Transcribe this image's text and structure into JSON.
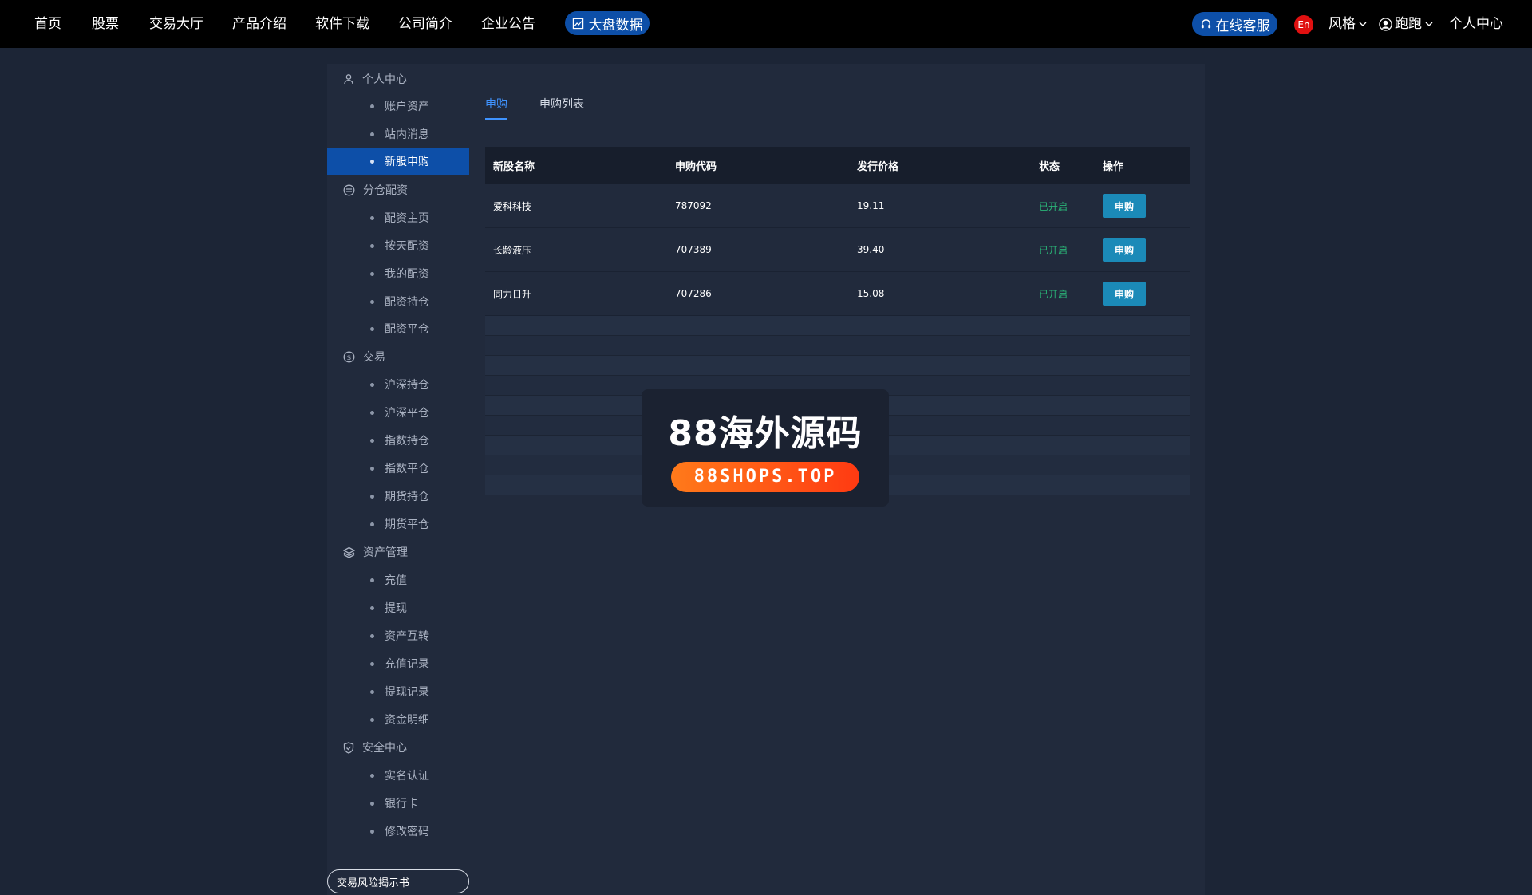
{
  "nav": {
    "items": [
      "首页",
      "股票",
      "交易大厅",
      "产品介绍",
      "软件下载",
      "公司简介",
      "企业公告"
    ],
    "bigdata_label": "大盘数据",
    "service_label": "在线客服",
    "lang_label": "En",
    "style_label": "风格",
    "user_label": "跑跑",
    "personal_center_label": "个人中心"
  },
  "sidebar": {
    "group_personal": "个人中心",
    "account_assets": "账户资产",
    "messages": "站内消息",
    "ipo_subscribe": "新股申购",
    "group_margin": "分仓配资",
    "margin_home": "配资主页",
    "daily_margin": "按天配资",
    "my_margin": "我的配资",
    "margin_positions": "配资持仓",
    "margin_closed": "配资平仓",
    "group_trade": "交易",
    "sh_sz_positions": "沪深持仓",
    "sh_sz_closed": "沪深平仓",
    "index_positions": "指数持仓",
    "index_closed": "指数平仓",
    "futures_positions": "期货持仓",
    "futures_closed": "期货平仓",
    "group_assets": "资产管理",
    "deposit": "充值",
    "withdraw": "提现",
    "transfer": "资产互转",
    "deposit_records": "充值记录",
    "withdraw_records": "提现记录",
    "fund_details": "资金明细",
    "group_security": "安全中心",
    "real_name": "实名认证",
    "bank_card": "银行卡",
    "change_password": "修改密码",
    "risk_disclosure": "交易风险揭示书"
  },
  "tabs": {
    "subscribe": "申购",
    "subscribe_list": "申购列表"
  },
  "table": {
    "headers": [
      "新股名称",
      "申购代码",
      "发行价格",
      "状态",
      "操作"
    ],
    "rows": [
      {
        "name": "爱科科技",
        "code": "787092",
        "price": "19.11",
        "status": "已开启",
        "action": "申购"
      },
      {
        "name": "长龄液压",
        "code": "707389",
        "price": "39.40",
        "status": "已开启",
        "action": "申购"
      },
      {
        "name": "同力日升",
        "code": "707286",
        "price": "15.08",
        "status": "已开启",
        "action": "申购"
      }
    ]
  },
  "watermark": {
    "title": "88海外源码",
    "subtitle": "88SHOPS.TOP"
  },
  "colors": {
    "accent": "#0d4fa8",
    "tab_active": "#3f93ff",
    "status_open": "#2ab577",
    "button": "#1b8ab8"
  }
}
